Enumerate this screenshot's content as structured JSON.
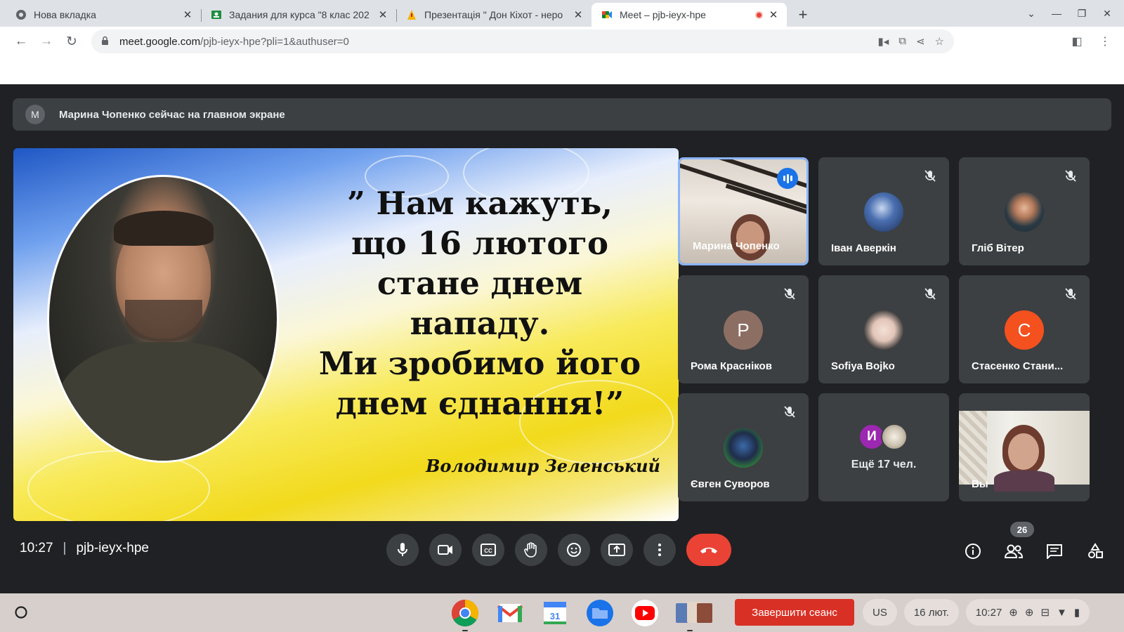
{
  "browser": {
    "tabs": [
      {
        "title": "Нова вкладка",
        "active": false
      },
      {
        "title": "Задания для курса \"8 клас 202",
        "active": false
      },
      {
        "title": "Презентація \" Дон Кіхот - неро",
        "active": false
      },
      {
        "title": "Meet – pjb-ieyx-hpe",
        "active": true,
        "recording": true
      }
    ],
    "url_host": "meet.google.com",
    "url_path": "/pjb-ieyx-hpe?pli=1&authuser=0"
  },
  "banner": {
    "initial": "M",
    "text": "Марина Чопенко сейчас на главном экране"
  },
  "slide": {
    "quote_lines": [
      "” Нам кажуть,",
      "що 16 лютого",
      "стане днем",
      "нападу.",
      "Ми зробимо його",
      "днем єднання!”"
    ],
    "signature": "Володимир Зеленський"
  },
  "participants": [
    {
      "name": "Марина Чопенко",
      "speaking": true,
      "video": true
    },
    {
      "name": "Іван Аверкін",
      "muted": true,
      "avatar": "photo-ship"
    },
    {
      "name": "Гліб Вітер",
      "muted": true,
      "avatar": "photo-memoji"
    },
    {
      "name": "Рома Красніков",
      "muted": true,
      "initial": "Р",
      "color": "#8d6e63"
    },
    {
      "name": "Sofiya Bojko",
      "muted": true,
      "avatar": "photo-character"
    },
    {
      "name": "Стасенко Стани...",
      "muted": true,
      "initial": "С",
      "color": "#f4511e"
    },
    {
      "name": "Євген Суворов",
      "muted": true,
      "avatar": "photo-anime"
    },
    {
      "more_label": "Ещё 17 чел.",
      "initials": [
        "И"
      ],
      "color": "#9c27b0"
    },
    {
      "name": "Вы",
      "video": true
    }
  ],
  "meeting": {
    "time": "10:27",
    "code": "pjb-ieyx-hpe",
    "people_count": "26"
  },
  "shelf": {
    "end_session": "Завершити сеанс",
    "locale": "US",
    "date": "16 лют.",
    "time": "10:27"
  }
}
